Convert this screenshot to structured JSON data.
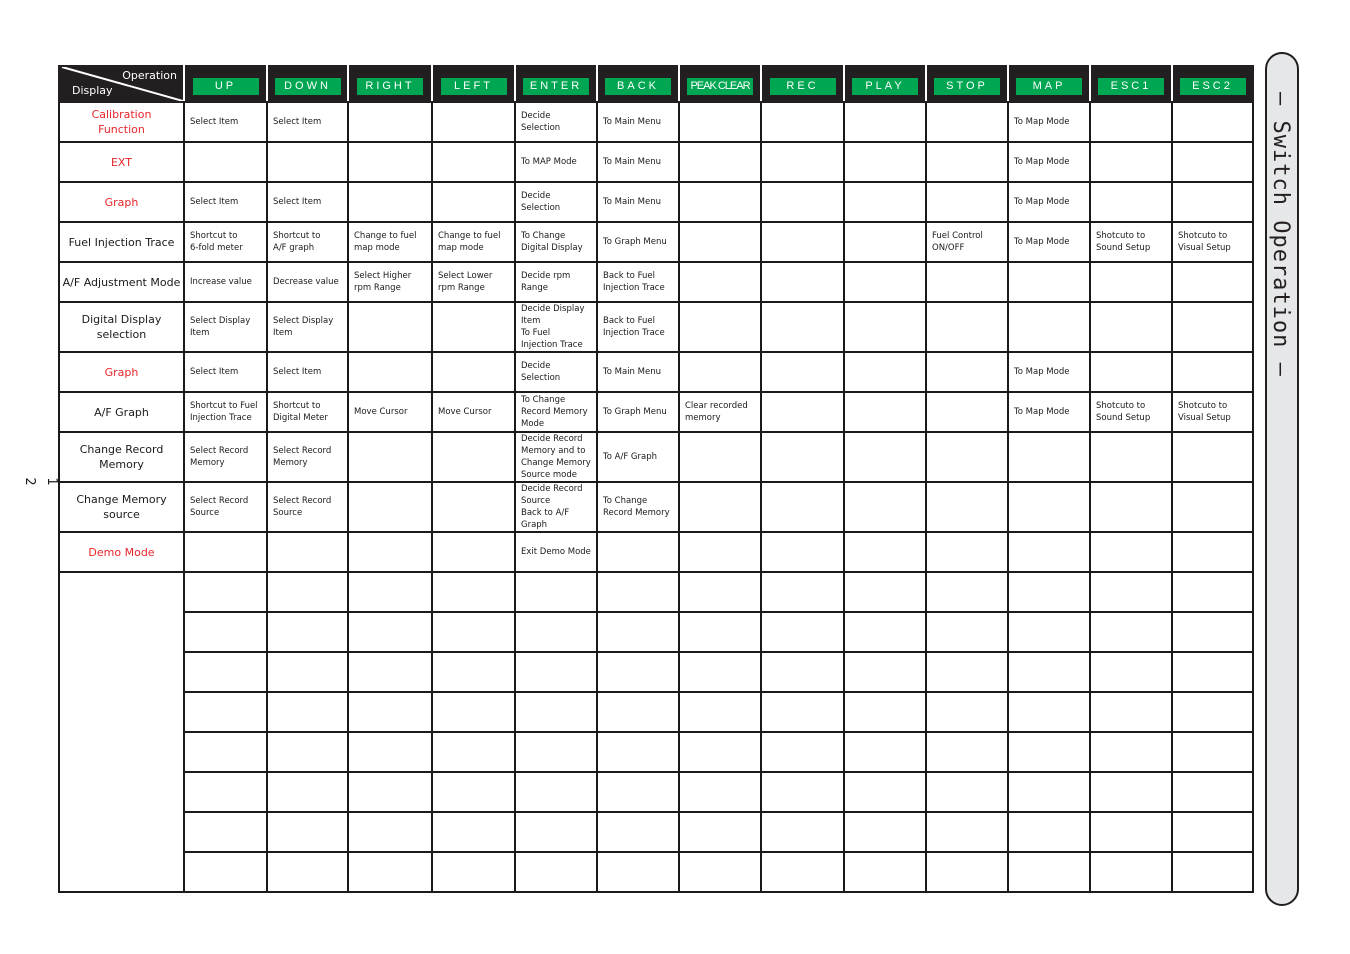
{
  "page_number": "1 2",
  "side_tab_title": "— Switch Operation —",
  "header": {
    "corner_operation": "Operation",
    "corner_display": "Display",
    "keys": [
      "UP",
      "DOWN",
      "RIGHT",
      "LEFT",
      "ENTER",
      "BACK",
      "PEAK CLEAR",
      "REC",
      "PLAY",
      "STOP",
      "MAP",
      "ESC1",
      "ESC2"
    ]
  },
  "colors": {
    "key_green": "#00a651",
    "header_black": "#231f20",
    "section_red": "#e8262c",
    "tab_gray": "#e6e7e8"
  },
  "rows": [
    {
      "label": "Calibration\nFunction",
      "red": true,
      "cells": [
        "Select Item",
        "Select Item",
        "",
        "",
        "Decide\nSelection",
        "To Main Menu",
        "",
        "",
        "",
        "",
        "To Map Mode",
        "",
        ""
      ]
    },
    {
      "label": "EXT",
      "red": true,
      "cells": [
        "",
        "",
        "",
        "",
        "To MAP Mode",
        "To Main Menu",
        "",
        "",
        "",
        "",
        "To Map Mode",
        "",
        ""
      ]
    },
    {
      "label": "Graph",
      "red": true,
      "cells": [
        "Select Item",
        "Select Item",
        "",
        "",
        "Decide\nSelection",
        "To Main Menu",
        "",
        "",
        "",
        "",
        "To Map Mode",
        "",
        ""
      ]
    },
    {
      "label": "Fuel Injection Trace",
      "red": false,
      "cells": [
        "Shortcut to\n6-fold meter",
        "Shortcut to\nA/F graph",
        "Change to fuel\nmap mode",
        "Change to fuel\nmap mode",
        "To Change\nDigital Display",
        "To Graph Menu",
        "",
        "",
        "",
        "Fuel Control\nON/OFF",
        "To Map Mode",
        "Shotcuto to\nSound Setup",
        "Shotcuto to\nVisual Setup"
      ]
    },
    {
      "label": "A/F Adjustment Mode",
      "red": false,
      "cells": [
        "Increase value",
        "Decrease value",
        "Select Higher\nrpm Range",
        "Select Lower\nrpm Range",
        "Decide rpm Range",
        "Back to Fuel\nInjection Trace",
        "",
        "",
        "",
        "",
        "",
        "",
        ""
      ]
    },
    {
      "label": "Digital Display selection",
      "red": false,
      "cells": [
        "Select Display Item",
        "Select Display Item",
        "",
        "",
        "Decide Display Item\nTo Fuel\nInjection Trace",
        "Back to Fuel\nInjection Trace",
        "",
        "",
        "",
        "",
        "",
        "",
        ""
      ]
    },
    {
      "label": "Graph",
      "red": true,
      "cells": [
        "Select Item",
        "Select Item",
        "",
        "",
        "Decide\nSelection",
        "To Main Menu",
        "",
        "",
        "",
        "",
        "To Map Mode",
        "",
        ""
      ]
    },
    {
      "label": "A/F Graph",
      "red": false,
      "cells": [
        "Shortcut to Fuel\nInjection Trace",
        "Shortcut to\nDigital Meter",
        "Move Cursor",
        "Move Cursor",
        "To Change\nRecord Memory\nMode",
        "To Graph Menu",
        "Clear recorded\nmemory",
        "",
        "",
        "",
        "To Map Mode",
        "Shotcuto to\nSound Setup",
        "Shotcuto to\nVisual Setup"
      ]
    },
    {
      "label": "Change Record Memory",
      "red": false,
      "cells": [
        "Select Record\nMemory",
        "Select Record\nMemory",
        "",
        "",
        "Decide Record\nMemory and to\nChange Memory\nSource mode",
        "To A/F Graph",
        "",
        "",
        "",
        "",
        "",
        "",
        ""
      ]
    },
    {
      "label": "Change Memory source",
      "red": false,
      "cells": [
        "Select Record\nSource",
        "Select Record\nSource",
        "",
        "",
        "Decide Record Source\nBack to A/F Graph",
        "To Change\nRecord Memory",
        "",
        "",
        "",
        "",
        "",
        "",
        ""
      ]
    },
    {
      "label": "Demo Mode",
      "red": true,
      "cells": [
        "",
        "",
        "",
        "",
        "Exit Demo Mode",
        "",
        "",
        "",
        "",
        "",
        "",
        "",
        ""
      ]
    }
  ],
  "empty_rows": 8
}
